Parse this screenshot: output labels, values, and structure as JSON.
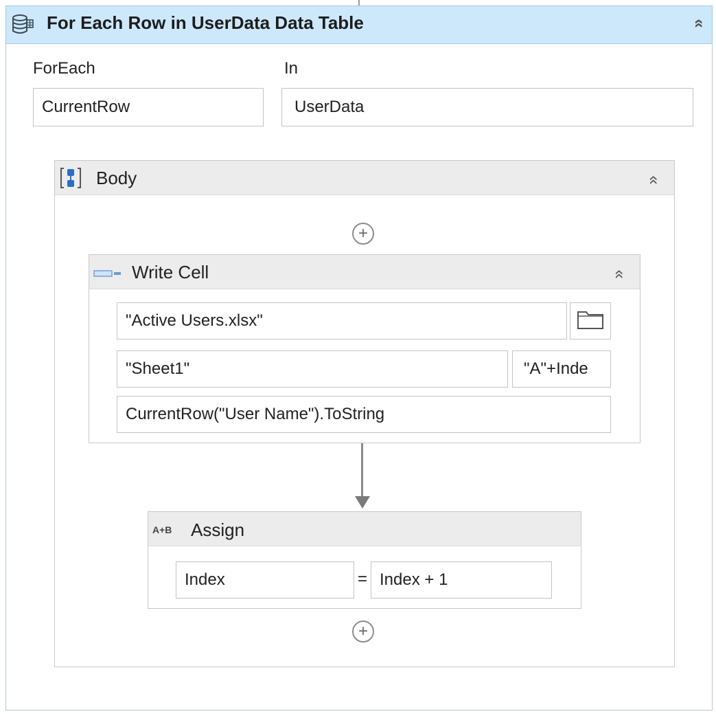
{
  "for_each": {
    "title": "For Each Row in UserData Data Table",
    "foreach_label": "ForEach",
    "in_label": "In",
    "item_value": "CurrentRow",
    "in_value": "UserData",
    "collapse_glyph": "«"
  },
  "body": {
    "title": "Body",
    "icon": "sequence-icon"
  },
  "write_cell": {
    "title": "Write Cell",
    "icon": "write-cell-icon",
    "workbook_path": "\"Active Users.xlsx\"",
    "sheet_name": "\"Sheet1\"",
    "cell": "\"A\"+Inde",
    "value": "CurrentRow(\"User Name\").ToString"
  },
  "assign": {
    "title": "Assign",
    "icon_text": "A+B",
    "to": "Index",
    "equals": "=",
    "value": "Index + 1"
  },
  "add_glyph": "+",
  "colors": {
    "header_blue": "#cde8fb",
    "header_gray": "#ececec",
    "border": "#c4c4c4"
  }
}
